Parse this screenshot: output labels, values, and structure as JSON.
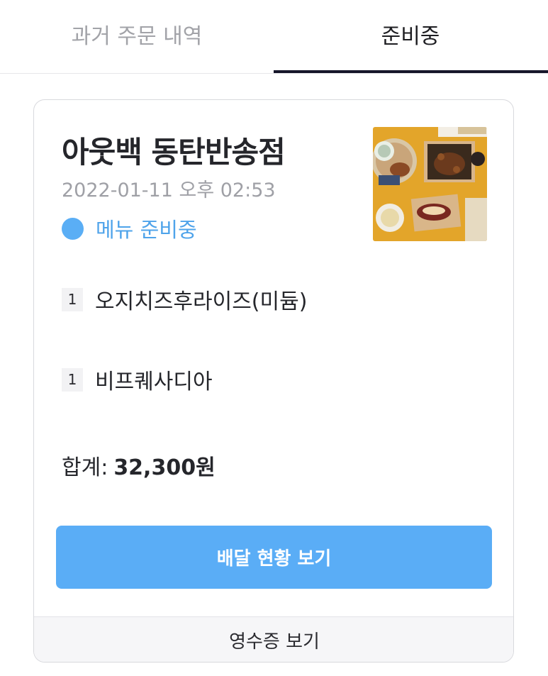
{
  "tabs": {
    "past_orders": "과거 주문 내역",
    "preparing": "준비중"
  },
  "order": {
    "store_name": "아웃백 동탄반송점",
    "datetime": "2022-01-11 오후 02:53",
    "status": "메뉴 준비중",
    "status_color": "#5aaef5",
    "items": [
      {
        "qty": "1",
        "name": "오지치즈후라이즈(미듐)"
      },
      {
        "qty": "1",
        "name": "비프퀘사디아"
      }
    ],
    "total_label": "합계:",
    "total_value": "32,300원"
  },
  "actions": {
    "track_delivery": "배달 현황 보기",
    "view_receipt": "영수증 보기"
  },
  "colors": {
    "accent": "#5aadf6",
    "tab_indicator": "#16162a"
  }
}
